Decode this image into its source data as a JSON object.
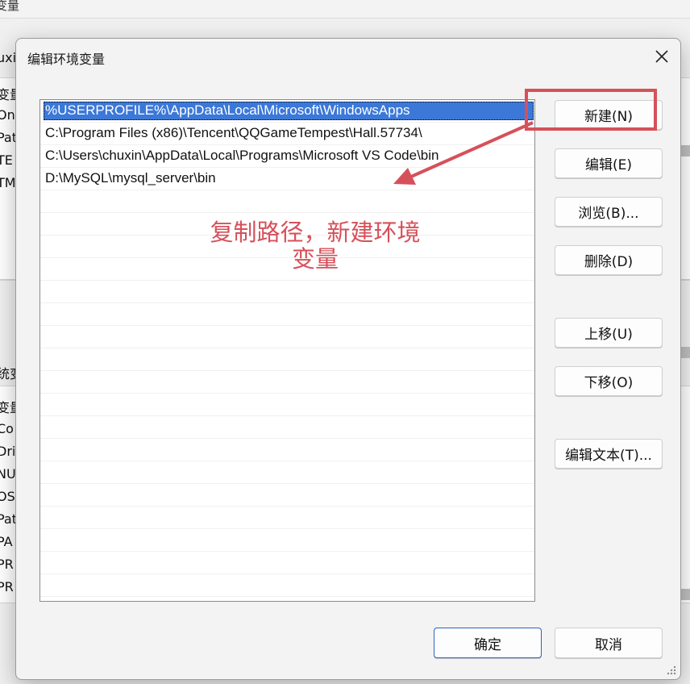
{
  "background": {
    "title_fragment": "变量",
    "left_fragments_top": [
      "uxi",
      "变量",
      "On",
      "Pat",
      "TE",
      "TM"
    ],
    "left_fragments_bottom": [
      "统变",
      "变量",
      "Co",
      "Dri",
      "NU",
      "OS",
      "Pat",
      "PA",
      "PR",
      "PR"
    ]
  },
  "dialog": {
    "title": "编辑环境变量",
    "close_glyph": "✕",
    "paths": [
      "%USERPROFILE%\\AppData\\Local\\Microsoft\\WindowsApps",
      "C:\\Program Files (x86)\\Tencent\\QQGameTempest\\Hall.57734\\",
      "C:\\Users\\chuxin\\AppData\\Local\\Programs\\Microsoft VS Code\\bin",
      "D:\\MySQL\\mysql_server\\bin"
    ],
    "selected_index": 0,
    "buttons": {
      "new": "新建(N)",
      "edit": "编辑(E)",
      "browse": "浏览(B)...",
      "delete": "删除(D)",
      "move_up": "上移(U)",
      "move_down": "下移(O)",
      "edit_text": "编辑文本(T)..."
    },
    "footer": {
      "ok": "确定",
      "cancel": "取消"
    }
  },
  "annotation": {
    "line1": "复制路径，新建环境",
    "line2": "变量",
    "color": "#d6505a"
  },
  "colors": {
    "selection": "#3b78d8",
    "primary_border": "#2b63c4"
  }
}
